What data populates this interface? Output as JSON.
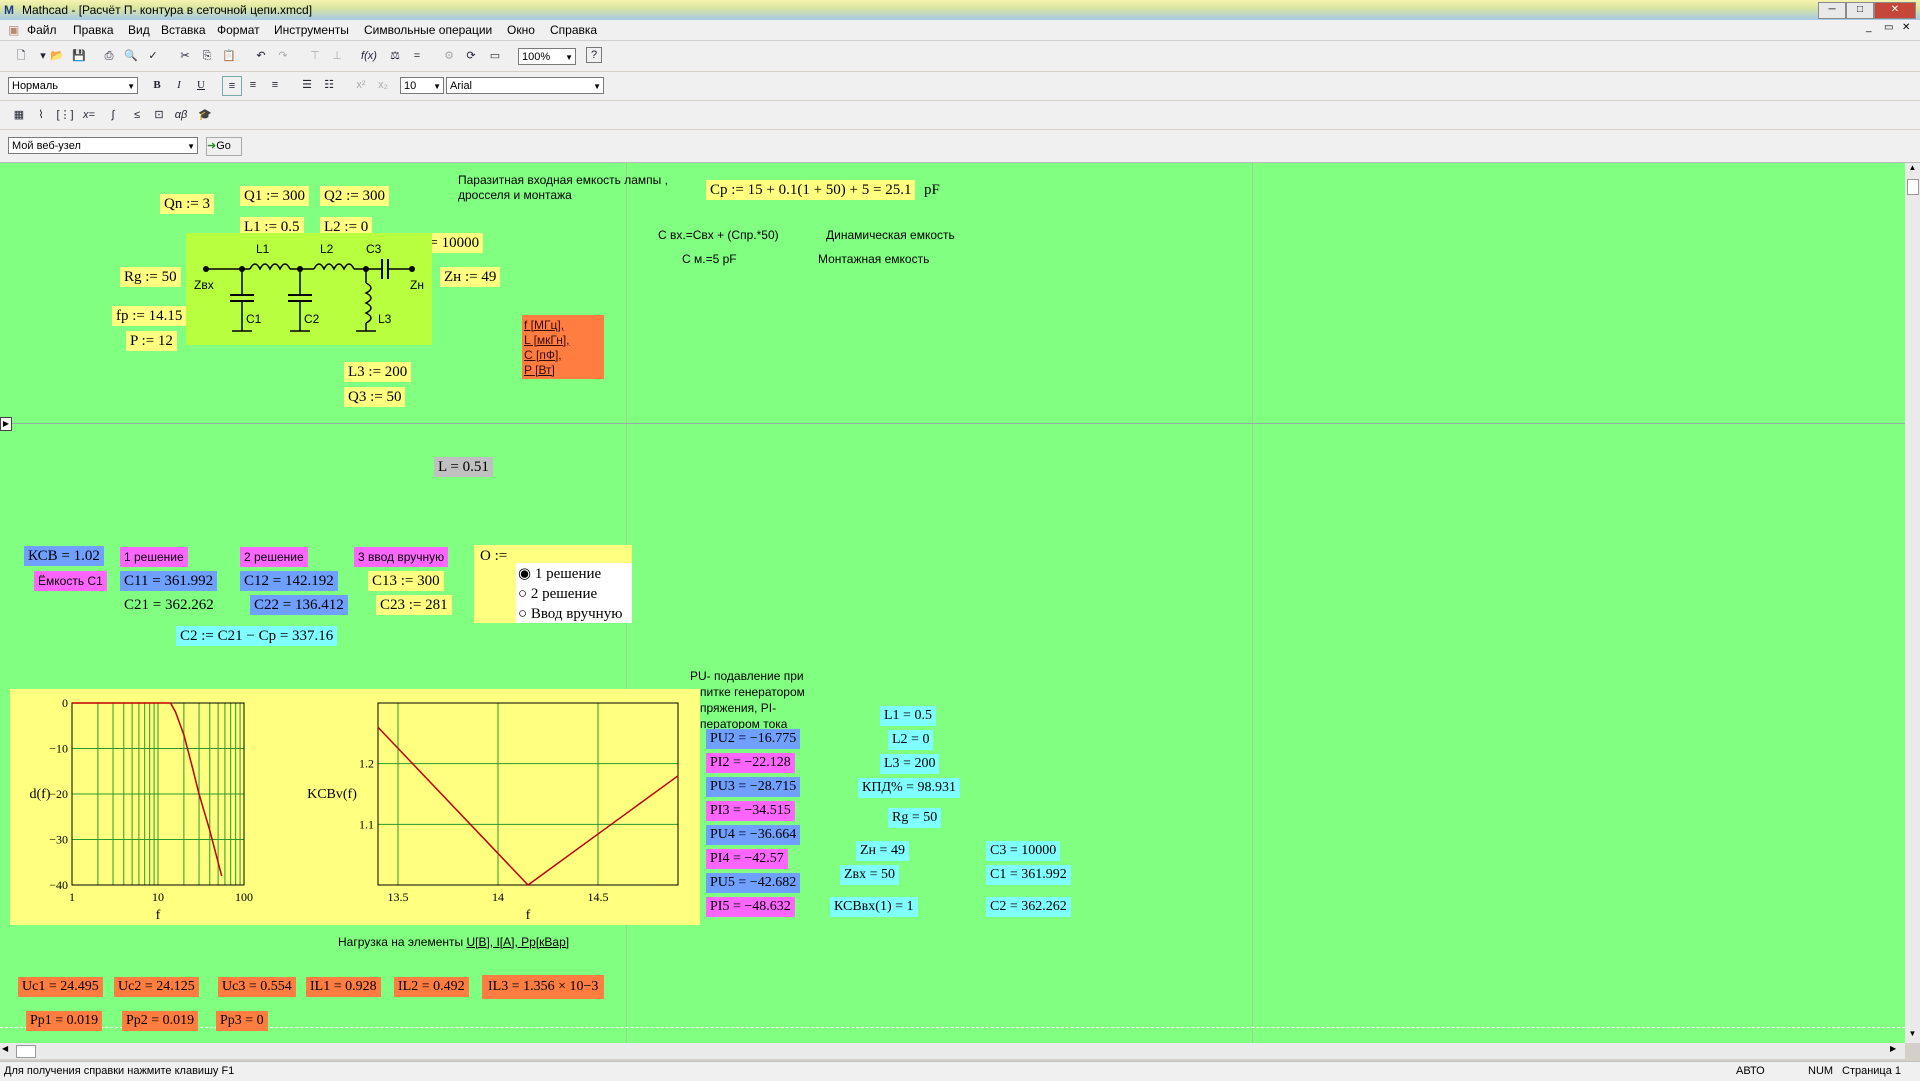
{
  "window": {
    "app": "Mathcad",
    "title": "Mathcad - [Расчёт П- контура в сеточной цепи.xmcd]"
  },
  "menu": [
    "Файл",
    "Правка",
    "Вид",
    "Вставка",
    "Формат",
    "Инструменты",
    "Символьные операции",
    "Окно",
    "Справка"
  ],
  "format_bar": {
    "style": "Нормаль",
    "font_size": "10",
    "font": "Arial",
    "bold": "B",
    "italic": "I",
    "underline": "U"
  },
  "toolbar": {
    "zoom": "100%"
  },
  "web_bar": {
    "address": "Мой веб-узел",
    "go": "Go"
  },
  "sheet": {
    "Qn": "Qn := 3",
    "Q1": "Q1 := 300",
    "Q2": "Q2 := 300",
    "L1": "L1 := 0.5",
    "L2": "L2 := 0",
    "C3": "C3 := 10000",
    "Rg": "Rg := 50",
    "Zn": "Zн := 49",
    "fp": "fр := 14.15",
    "P": "P := 12",
    "L3": "L3 := 200",
    "Q3": "Q3 := 50",
    "circuit": {
      "L1": "L1",
      "L2": "L2",
      "C3": "C3",
      "Zvx": "Zвх",
      "Zn": "Zн",
      "C1": "C1",
      "C2": "C2",
      "L3": "L3"
    },
    "note_title": "Паразитная входная емкость лампы ,",
    "note_title2": "дросселя и монтажа",
    "Cp": "Cp := 15 + 0.1(1 + 50) + 5 = 25.1",
    "Cp_unit": "pF",
    "dyn1": "С вх.=Свх + (Спр.*50)",
    "dyn2": "Динамическая емкость",
    "mont1": "С м.=5 pF",
    "mont2": "Монтажная емкость",
    "units": [
      "f [МГц],",
      "L [мкГн],",
      "C [пФ],",
      "P [Вт]"
    ],
    "L": "L = 0.51",
    "KSV": "КСВ = 1.02",
    "sol1": "1 решение",
    "sol2": "2 решение",
    "sol3": "3 ввод вручную",
    "cap1": "Ёмкость С1",
    "C11": "C11 = 361.992",
    "C12": "C12 = 142.192",
    "C13": "C13 := 300",
    "C21": "C21 = 362.262",
    "C22": "C22 = 136.412",
    "C23": "C23 := 281",
    "C2def": "C2 := C21 − Cp = 337.16",
    "O": "O :=",
    "radio": [
      "1 решение",
      "2 решение",
      "Ввод вручную"
    ],
    "pu_note": [
      "PU- подавление при",
      "питке генератором",
      "пряжения, PI-",
      "ператором тока"
    ],
    "PU": [
      "PU2 = −16.775",
      "PU3 = −28.715",
      "PU4 = −36.664",
      "PU5 = −42.682"
    ],
    "PI": [
      "PI2 = −22.128",
      "PI3 = −34.515",
      "PI4 = −42.57",
      "PI5 = −48.632"
    ],
    "right": {
      "L1": "L1 = 0.5",
      "L2": "L2 = 0",
      "L3": "L3 = 200",
      "kpd": "КПД% = 98.931",
      "Rg": "Rg = 50",
      "Zn": "Zн = 49",
      "Zvx": "Zвх = 50",
      "ksv": "КСВвх(1) = 1",
      "C3": "C3 = 10000",
      "C1": "C1 = 361.992",
      "C2": "C2 = 362.262"
    },
    "load_title": "Нагрузка на элементы ",
    "load_units": "U[В], I[А], Pр[кВар]",
    "U": [
      "Uc1 = 24.495",
      "Uc2 = 24.125",
      "Uc3 = 0.554"
    ],
    "I": [
      "IL1 = 0.928",
      "IL2 = 0.492",
      "IL3 = 1.356 × 10−3"
    ],
    "Pp": [
      "Pp1 = 0.019",
      "Pp2 = 0.019",
      "Pp3 = 0"
    ]
  },
  "chart_data": [
    {
      "type": "line",
      "xlabel": "f",
      "ylabel": "d(f)",
      "xscale": "log",
      "xlim": [
        1,
        100
      ],
      "ylim": [
        -40,
        0
      ],
      "xticks": [
        "1",
        "10",
        "100"
      ],
      "yticks": [
        "0",
        "−10",
        "−20",
        "−30",
        "−40"
      ],
      "x": [
        1,
        2,
        4,
        8,
        11,
        14,
        16,
        20,
        25,
        30,
        40,
        55
      ],
      "y": [
        0,
        0,
        0,
        0,
        0,
        0,
        -2,
        -7,
        -14,
        -20,
        -28,
        -38
      ],
      "grid": true
    },
    {
      "type": "line",
      "xlabel": "f",
      "ylabel": "KCBv(f)",
      "xlim": [
        13.4,
        14.9
      ],
      "ylim": [
        1.0,
        1.3
      ],
      "xticks": [
        "13.5",
        "14",
        "14.5"
      ],
      "yticks": [
        "1.2",
        "1.1"
      ],
      "x": [
        13.4,
        14.15,
        14.9
      ],
      "y": [
        1.26,
        1.0,
        1.18
      ],
      "grid": true
    }
  ],
  "statusbar": {
    "help": "Для получения справки нажмите клавишу F1",
    "mode": "АВТО",
    "num": "NUM",
    "page": "Страница 1"
  },
  "colors": {
    "worksheet": "#80ff80",
    "yellow": "#ffff80",
    "blue": "#6fa0ff",
    "cyan": "#80ffff",
    "magenta": "#ff66ff",
    "orange": "#ff7d40",
    "circuit": "#b8ff40"
  }
}
